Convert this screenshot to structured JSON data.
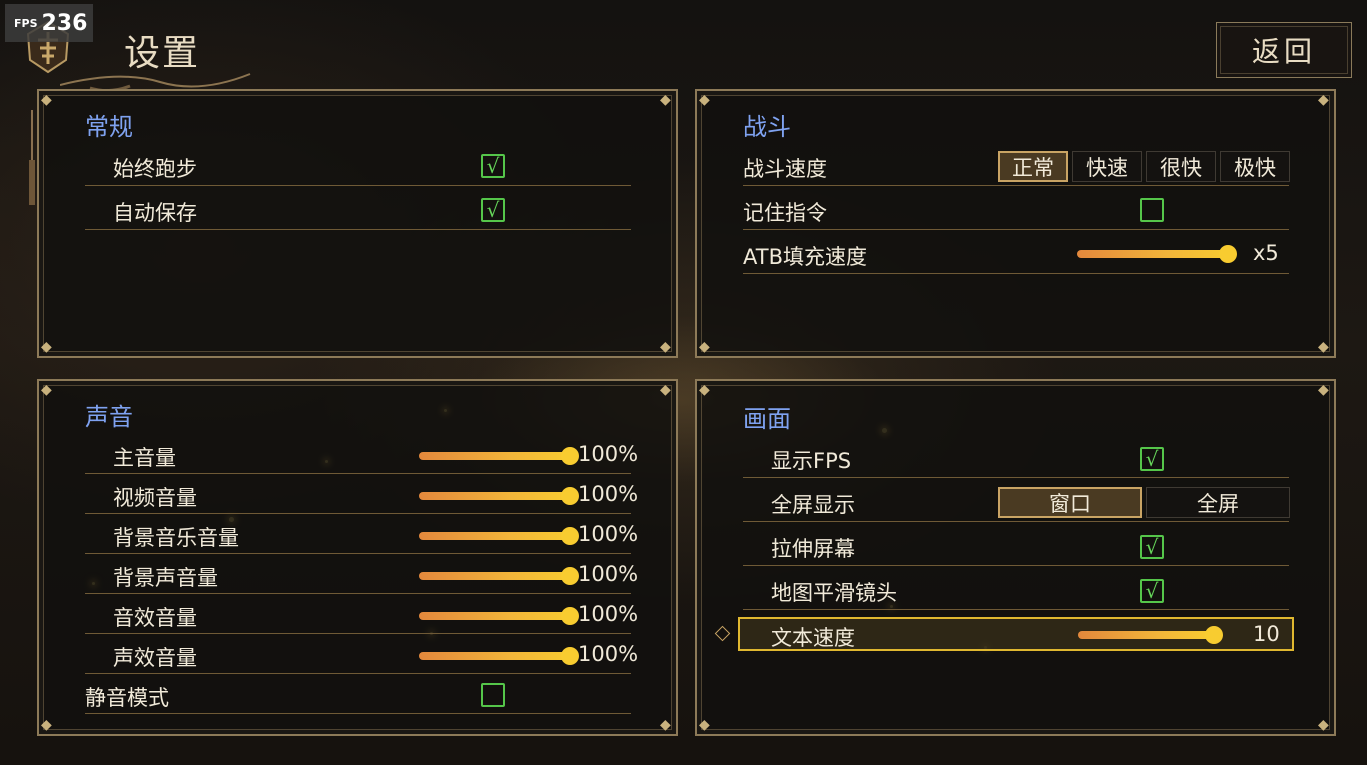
{
  "fps": {
    "label": "FPS",
    "value": "236"
  },
  "header": {
    "title": "设置",
    "back_label": "返回"
  },
  "general": {
    "title": "常规",
    "items": [
      {
        "label": "始终跑步",
        "checked": true
      },
      {
        "label": "自动保存",
        "checked": true
      }
    ]
  },
  "battle": {
    "title": "战斗",
    "speed_label": "战斗速度",
    "speed_options": [
      "正常",
      "快速",
      "很快",
      "极快"
    ],
    "speed_selected": "正常",
    "remember_label": "记住指令",
    "remember_checked": false,
    "atb_label": "ATB填充速度",
    "atb_value": "x5"
  },
  "sound": {
    "title": "声音",
    "items": [
      {
        "label": "主音量",
        "value": "100%"
      },
      {
        "label": "视频音量",
        "value": "100%"
      },
      {
        "label": "背景音乐音量",
        "value": "100%"
      },
      {
        "label": "背景声音量",
        "value": "100%"
      },
      {
        "label": "音效音量",
        "value": "100%"
      },
      {
        "label": "声效音量",
        "value": "100%"
      }
    ],
    "mute_label": "静音模式",
    "mute_checked": false
  },
  "display": {
    "title": "画面",
    "fps_label": "显示FPS",
    "fps_checked": true,
    "fullscreen_label": "全屏显示",
    "fullscreen_options": [
      "窗口",
      "全屏"
    ],
    "fullscreen_selected": "窗口",
    "stretch_label": "拉伸屏幕",
    "stretch_checked": true,
    "smooth_label": "地图平滑镜头",
    "smooth_checked": true,
    "text_speed_label": "文本速度",
    "text_speed_value": "10"
  },
  "check_glyph": "√",
  "colors": {
    "accent_blue": "#7fa2f0",
    "check_green": "#55c64a",
    "gold": "#e0b830"
  }
}
